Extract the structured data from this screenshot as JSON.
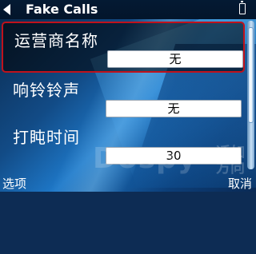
{
  "header": {
    "title": "Fake Calls",
    "back_icon": "back-arrow-icon",
    "status_icon": "battery-icon"
  },
  "settings": [
    {
      "label": "运营商名称",
      "value": "无",
      "selected": true
    },
    {
      "label": "响铃铃声",
      "value": "无",
      "selected": false
    },
    {
      "label": "打盹时间",
      "value": "30",
      "selected": false
    }
  ],
  "watermark": {
    "text": "Dospy",
    "cn": "适如方向"
  },
  "softkeys": {
    "left": "选项",
    "right": "取消"
  },
  "colors": {
    "highlight_border": "#c0121c",
    "title_bar": "#041a33"
  }
}
